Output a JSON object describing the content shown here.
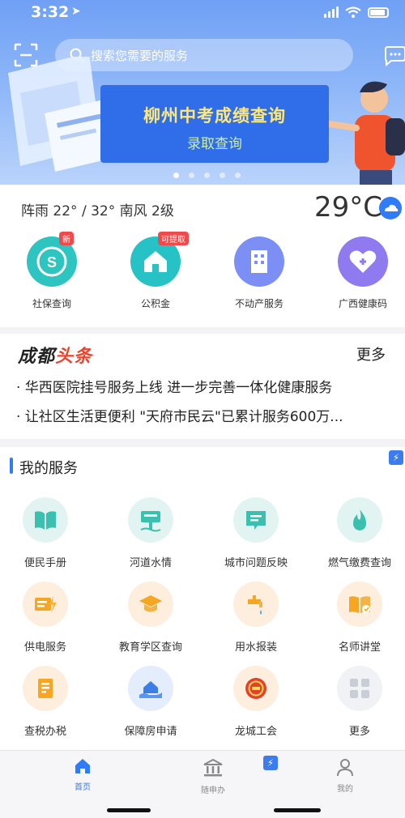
{
  "status_bar": {
    "time": "3:32",
    "location_arrow": "➤"
  },
  "header": {
    "search_placeholder": "搜索您需要的服务"
  },
  "banner": {
    "title": "柳州中考成绩查询",
    "subtitle": "录取查询",
    "page_count": 5,
    "active_page": 1
  },
  "weather": {
    "text": "阵雨 22° / 32° 南风 2级",
    "temperature": "29°C"
  },
  "quick_services": [
    {
      "label": "社保查询",
      "badge": "新",
      "color": "#2ec4c0",
      "icon": "social-security-icon"
    },
    {
      "label": "公积金",
      "badge": "可提取",
      "color": "#27c2c6",
      "icon": "house-icon"
    },
    {
      "label": "不动产服务",
      "badge": "",
      "color": "#7b8ff5",
      "icon": "building-icon"
    },
    {
      "label": "广西健康码",
      "badge": "",
      "color": "#8f7af0",
      "icon": "health-heart-icon"
    }
  ],
  "news": {
    "logo_black": "成都",
    "logo_red": "头条",
    "more": "更多",
    "items": [
      "· 华西医院挂号服务上线   进一步完善一体化健康服务",
      "· 让社区生活更便利 \"天府市民云\"已累计服务600万..."
    ]
  },
  "my_services": {
    "title": "我的服务",
    "items": [
      {
        "label": "便民手册",
        "icon": "book-icon",
        "tone": "teal"
      },
      {
        "label": "河道水情",
        "icon": "river-sign-icon",
        "tone": "teal"
      },
      {
        "label": "城市问题反映",
        "icon": "feedback-icon",
        "tone": "teal"
      },
      {
        "label": "燃气缴费查询",
        "icon": "flame-icon",
        "tone": "teal"
      },
      {
        "label": "供电服务",
        "icon": "electricity-icon",
        "tone": "orange"
      },
      {
        "label": "教育学区查询",
        "icon": "graduation-cap-icon",
        "tone": "orange"
      },
      {
        "label": "用水报装",
        "icon": "water-tap-icon",
        "tone": "orange"
      },
      {
        "label": "名师讲堂",
        "icon": "lecture-book-icon",
        "tone": "orange"
      },
      {
        "label": "查税办税",
        "icon": "tax-icon",
        "tone": "orange"
      },
      {
        "label": "保障房申请",
        "icon": "home-hand-icon",
        "tone": "blue"
      },
      {
        "label": "龙城工会",
        "icon": "union-emblem-icon",
        "tone": "red"
      },
      {
        "label": "更多",
        "icon": "grid-more-icon",
        "tone": "grey"
      }
    ]
  },
  "tabbar": [
    {
      "label": "首页",
      "icon": "home-icon",
      "active": true
    },
    {
      "label": "随申办",
      "icon": "government-building-icon",
      "active": false
    },
    {
      "label": "我的",
      "icon": "person-icon",
      "active": false
    }
  ],
  "colors": {
    "accent": "#2f7cf6",
    "hero_top": "#6fa0f5",
    "news_red": "#e8452b"
  }
}
